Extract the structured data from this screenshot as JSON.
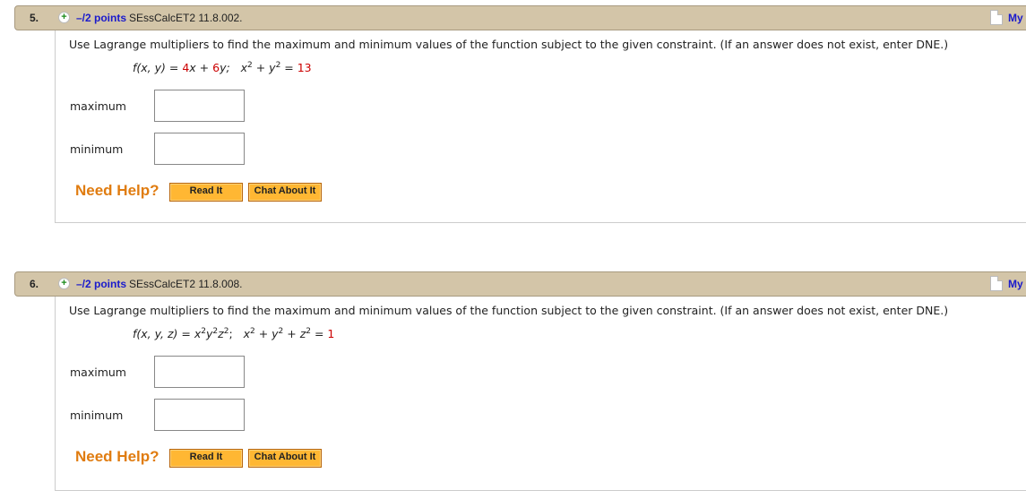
{
  "questions": [
    {
      "number": "5.",
      "points": "–/2 points",
      "source": "SEssCalcET2 11.8.002.",
      "my_link": "My",
      "prompt": "Use Lagrange multipliers to find the maximum and minimum values of the function subject to the given constraint. (If an answer does not exist, enter DNE.)",
      "formula": {
        "f_lhs": "f(x, y)",
        "eq": " = ",
        "c1": "4",
        "t1": "x + ",
        "c2": "6",
        "t2": "y;",
        "constraint_a": "x",
        "constraint_b": " + y",
        "constraint_c": " = ",
        "rhs": "13"
      },
      "fields": [
        {
          "label": "maximum",
          "value": ""
        },
        {
          "label": "minimum",
          "value": ""
        }
      ],
      "need_help": "Need Help?",
      "read_it": "Read It",
      "chat_about_it": "Chat About It"
    },
    {
      "number": "6.",
      "points": "–/2 points",
      "source": "SEssCalcET2 11.8.008.",
      "my_link": "My",
      "prompt": "Use Lagrange multipliers to find the maximum and minimum values of the function subject to the given constraint. (If an answer does not exist, enter DNE.)",
      "formula": {
        "f_lhs": "f(x, y, z)",
        "eq": " = ",
        "fx": "x",
        "fy": "y",
        "fz": "z",
        "semi": ";",
        "cx": "x",
        "cy": " + y",
        "cz": " + z",
        "ceq": " = ",
        "rhs": "1"
      },
      "fields": [
        {
          "label": "maximum",
          "value": ""
        },
        {
          "label": "minimum",
          "value": ""
        }
      ],
      "need_help": "Need Help?",
      "read_it": "Read It",
      "chat_about_it": "Chat About It"
    }
  ],
  "sup2": "2",
  "icons": {
    "expand": "plus-circle-icon",
    "my_notes": "document-icon"
  },
  "colors": {
    "header_bg": "#d3c5a8",
    "link": "#1a1acc",
    "help": "#e07c10",
    "button": "#ffb733",
    "emphasis": "#cc0000"
  }
}
